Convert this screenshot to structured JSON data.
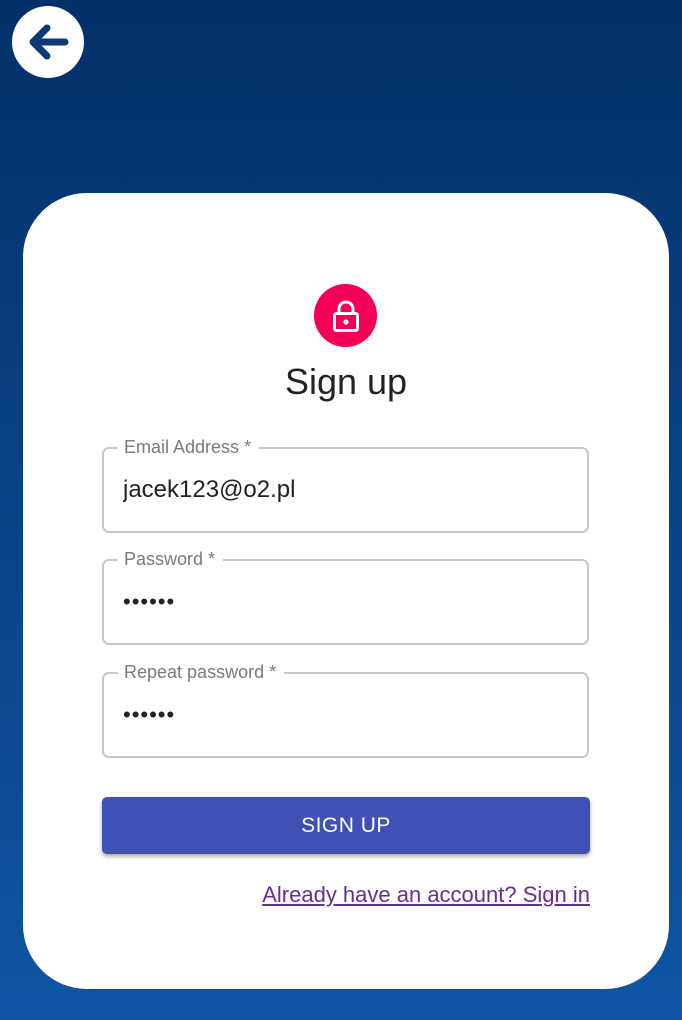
{
  "colors": {
    "accent": "#f50057",
    "primary": "#3f51b5",
    "link": "#6a2d8f",
    "background_top": "#033069",
    "background_bottom": "#0f55a3"
  },
  "header": {
    "back_icon": "arrow-left-icon"
  },
  "form": {
    "avatar_icon": "lock-icon",
    "title": "Sign up",
    "fields": [
      {
        "label": "Email Address *",
        "value": "jacek123@o2.pl",
        "type": "email"
      },
      {
        "label": "Password *",
        "value": "123456",
        "type": "password"
      },
      {
        "label": "Repeat password *",
        "value": "123456",
        "type": "password"
      }
    ],
    "submit_label": "SIGN UP",
    "signin_link": "Already have an account? Sign in"
  }
}
